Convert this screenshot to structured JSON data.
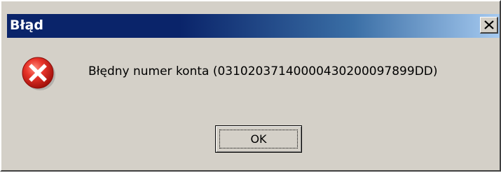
{
  "dialog": {
    "title": "Błąd",
    "message": "Błędny numer konta (03102037140000430200097899DD)",
    "ok_label": "OK",
    "close_icon": "close-icon",
    "status_icon": "error-icon"
  },
  "colors": {
    "titlebar_start": "#0a246a",
    "titlebar_end": "#a6caf0",
    "window_face": "#d4d0c8",
    "error_red": "#d9261c"
  }
}
